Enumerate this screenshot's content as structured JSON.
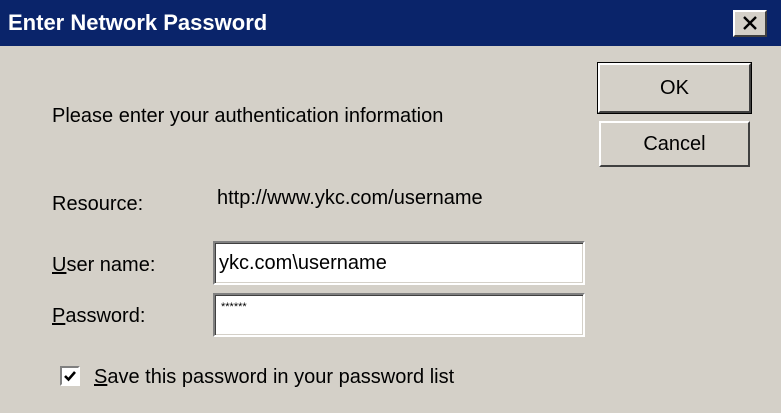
{
  "window": {
    "title": "Enter Network Password",
    "close_icon": "close-icon"
  },
  "buttons": {
    "ok_label": "OK",
    "cancel_label": "Cancel"
  },
  "prompt": "Please enter your authentication information",
  "resource": {
    "label": "Resource:",
    "value": "http://www.ykc.com/username"
  },
  "username": {
    "label_mnemonic": "U",
    "label_rest": "ser name:",
    "value": "ykc.com\\username"
  },
  "password": {
    "label_mnemonic": "P",
    "label_rest": "assword:",
    "value": "******"
  },
  "save_password": {
    "checked": true,
    "label_mnemonic": "S",
    "label_rest": "ave this password in your password list"
  },
  "colors": {
    "titlebar": "#0a246a",
    "face": "#d4d0c8",
    "field": "#ffffff"
  }
}
